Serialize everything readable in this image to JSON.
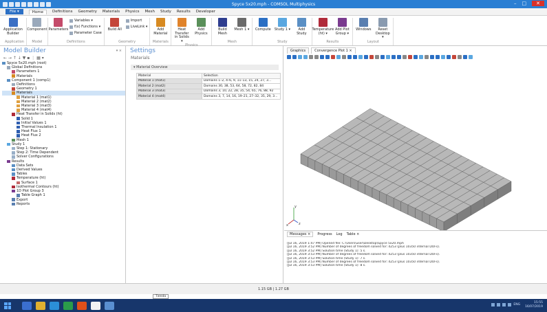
{
  "window": {
    "title": "Spyce 5x20.mph - COMSOL Multiphysics",
    "minimize": "–",
    "maximize": "□",
    "close": "✕"
  },
  "ribbon_tabs": [
    "File ▾",
    "Home",
    "Definitions",
    "Geometry",
    "Materials",
    "Physics",
    "Mesh",
    "Study",
    "Results",
    "Developer"
  ],
  "ribbon_groups": [
    {
      "label": "Application",
      "buttons": [
        {
          "label": "Application Builder",
          "color": "#3b6fc4"
        }
      ]
    },
    {
      "label": "Model",
      "buttons": [
        {
          "label": "Component",
          "color": "#9aa9bb"
        }
      ]
    },
    {
      "label": "Definitions",
      "buttons": [
        {
          "label": "Parameters",
          "color": "#c44b6a"
        }
      ],
      "small": [
        "Variables ▾",
        "f(x) Functions ▾",
        "Parameter Case"
      ]
    },
    {
      "label": "Geometry",
      "buttons": [
        {
          "label": "Build All",
          "color": "#c4463a"
        }
      ],
      "small": [
        "Import",
        "LiveLink ▾"
      ]
    },
    {
      "label": "Materials",
      "buttons": [
        {
          "label": "Add Material",
          "color": "#d78a22"
        }
      ]
    },
    {
      "label": "Physics",
      "buttons": [
        {
          "label": "Heat Transfer in Solids ▾",
          "color": "#e0832b"
        },
        {
          "label": "Add Physics",
          "color": "#5a8f5a"
        }
      ]
    },
    {
      "label": "Mesh",
      "buttons": [
        {
          "label": "Build Mesh",
          "color": "#2f3e8f"
        },
        {
          "label": "Mesh 1 ▾",
          "color": "#6a6a6a"
        }
      ]
    },
    {
      "label": "Study",
      "buttons": [
        {
          "label": "Compute",
          "color": "#2b6fc4"
        },
        {
          "label": "Study 1 ▾",
          "color": "#5aa7e0"
        },
        {
          "label": "Add Study",
          "color": "#5a8fc4"
        }
      ]
    },
    {
      "label": "Results",
      "buttons": [
        {
          "label": "Temperature (ht) ▾",
          "color": "#b02b3a"
        },
        {
          "label": "Add Plot Group ▾",
          "color": "#7a3b8f"
        }
      ]
    },
    {
      "label": "Layout",
      "buttons": [
        {
          "label": "Windows",
          "color": "#5a7fb0"
        },
        {
          "label": "Reset Desktop ▾",
          "color": "#8a9bb0"
        }
      ]
    }
  ],
  "model_builder": {
    "title": "Model Builder",
    "pin": "▾ ⨯",
    "tools": "← → ↑ ↓ ▼ ▪ ⋮ ▦ ▾",
    "tree": [
      {
        "depth": 0,
        "label": "Spyce 5x20.mph (root)",
        "color": "#5a8fc4"
      },
      {
        "depth": 1,
        "label": "Global Definitions",
        "color": "#9aa9bb"
      },
      {
        "depth": 2,
        "label": "Parameters 1",
        "color": "#c44b6a"
      },
      {
        "depth": 2,
        "label": "Materials",
        "color": "#d78a22"
      },
      {
        "depth": 1,
        "label": "Component 1 (comp1)",
        "color": "#5a8fc4"
      },
      {
        "depth": 2,
        "label": "Definitions",
        "color": "#9aa9bb"
      },
      {
        "depth": 2,
        "label": "Geometry 1",
        "color": "#c4463a"
      },
      {
        "depth": 2,
        "label": "Materials",
        "color": "#d78a22",
        "selected": true
      },
      {
        "depth": 3,
        "label": "Material 1 (mat1)",
        "color": "#e0a040"
      },
      {
        "depth": 3,
        "label": "Material 2 (mat2)",
        "color": "#e0a040"
      },
      {
        "depth": 3,
        "label": "Material 3 (mat3)",
        "color": "#e0a040"
      },
      {
        "depth": 3,
        "label": "Material 4 (mat4)",
        "color": "#e0a040"
      },
      {
        "depth": 2,
        "label": "Heat Transfer in Solids (ht)",
        "color": "#b02b3a"
      },
      {
        "depth": 3,
        "label": "Solid 1",
        "color": "#2f5fb0"
      },
      {
        "depth": 3,
        "label": "Initial Values 1",
        "color": "#2f5fb0"
      },
      {
        "depth": 3,
        "label": "Thermal Insulation 1",
        "color": "#2f5fb0"
      },
      {
        "depth": 3,
        "label": "Heat Flux 1",
        "color": "#2f5fb0"
      },
      {
        "depth": 3,
        "label": "Heat Flux 2",
        "color": "#2f5fb0"
      },
      {
        "depth": 2,
        "label": "Mesh 1",
        "color": "#5a8f5a"
      },
      {
        "depth": 1,
        "label": "Study 1",
        "color": "#5aa7e0"
      },
      {
        "depth": 2,
        "label": "Step 1: Stationary",
        "color": "#9ab0c8"
      },
      {
        "depth": 2,
        "label": "Step 2: Time Dependent",
        "color": "#9ab0c8"
      },
      {
        "depth": 2,
        "label": "Solver Configurations",
        "color": "#9ab0c8"
      },
      {
        "depth": 1,
        "label": "Results",
        "color": "#7a3b8f"
      },
      {
        "depth": 2,
        "label": "Data Sets",
        "color": "#5a8fc4"
      },
      {
        "depth": 2,
        "label": "Derived Values",
        "color": "#5a8fc4"
      },
      {
        "depth": 2,
        "label": "Tables",
        "color": "#5a8fc4"
      },
      {
        "depth": 2,
        "label": "Temperature (ht)",
        "color": "#b02b3a"
      },
      {
        "depth": 3,
        "label": "Surface 1",
        "color": "#c46a6a"
      },
      {
        "depth": 2,
        "label": "Isothermal Contours (ht)",
        "color": "#b02b3a"
      },
      {
        "depth": 2,
        "label": "1D Plot Group 3",
        "color": "#7a3b8f"
      },
      {
        "depth": 3,
        "label": "Table Graph 1",
        "color": "#5a7fb0"
      },
      {
        "depth": 2,
        "label": "Export",
        "color": "#5a7fb0"
      },
      {
        "depth": 2,
        "label": "Reports",
        "color": "#5a7fb0"
      }
    ]
  },
  "settings": {
    "title": "Settings",
    "subtitle": "Materials",
    "section": "▾ Material Overview",
    "col_material": "Material",
    "col_selection": "Selection",
    "rows": [
      {
        "material": "Material 1 (mat1)",
        "selection": "Domains 1–2, 4–6, 9, 11–13, 15, 24, 27, 3..."
      },
      {
        "material": "Material 2 (mat2)",
        "selection": "Domains 30, 38, 53, 64, 58, 72, 82, 84"
      },
      {
        "material": "Material 3 (mat3)",
        "selection": "Domains 3, 10, 22, 28, 35, 54, 65, 76, 88, 92"
      },
      {
        "material": "Material 4 (mat4)",
        "selection": "Domains 3, 7, 14, 16, 19–21, 27–32, 35, 29, 3..."
      }
    ]
  },
  "graphics": {
    "tabs": [
      "Graphics",
      "Convergence Plot 1 ×"
    ],
    "axes": {
      "y": "y",
      "x": "x",
      "z": "z"
    }
  },
  "messages": {
    "tabs": [
      "Messages ×",
      "Progress",
      "Log",
      "Table ×"
    ],
    "lines": [
      "[Jul 16, 2019 1:47 PM] Opened file: C:\\Users\\user\\Desktop\\Spyce 5x20.mph",
      "[Jul 16, 2019 3:52 PM] Number of degrees of freedom solved for: 4253 (plus 10350 internal DOFs).",
      "[Jul 16, 2019 3:52 PM] Solution time (Study 1): 5 s.",
      "[Jul 16, 2019 3:53 PM] Number of degrees of freedom solved for: 4253 (plus 10350 internal DOFs).",
      "[Jul 16, 2019 3:53 PM] Solution time (Study 1): 7 s.",
      "[Jul 16, 2019 3:53 PM] Number of degrees of freedom solved for: 4253 (plus 10350 internal DOFs).",
      "[Jul 16, 2019 3:53 PM] Solution time (Study 1): 8 s."
    ]
  },
  "status": "1.15 GB | 1.27 GB",
  "tooltip": "Tienda",
  "tray": {
    "lang": "ENG",
    "time": "15:55",
    "date": "16/07/2019"
  }
}
